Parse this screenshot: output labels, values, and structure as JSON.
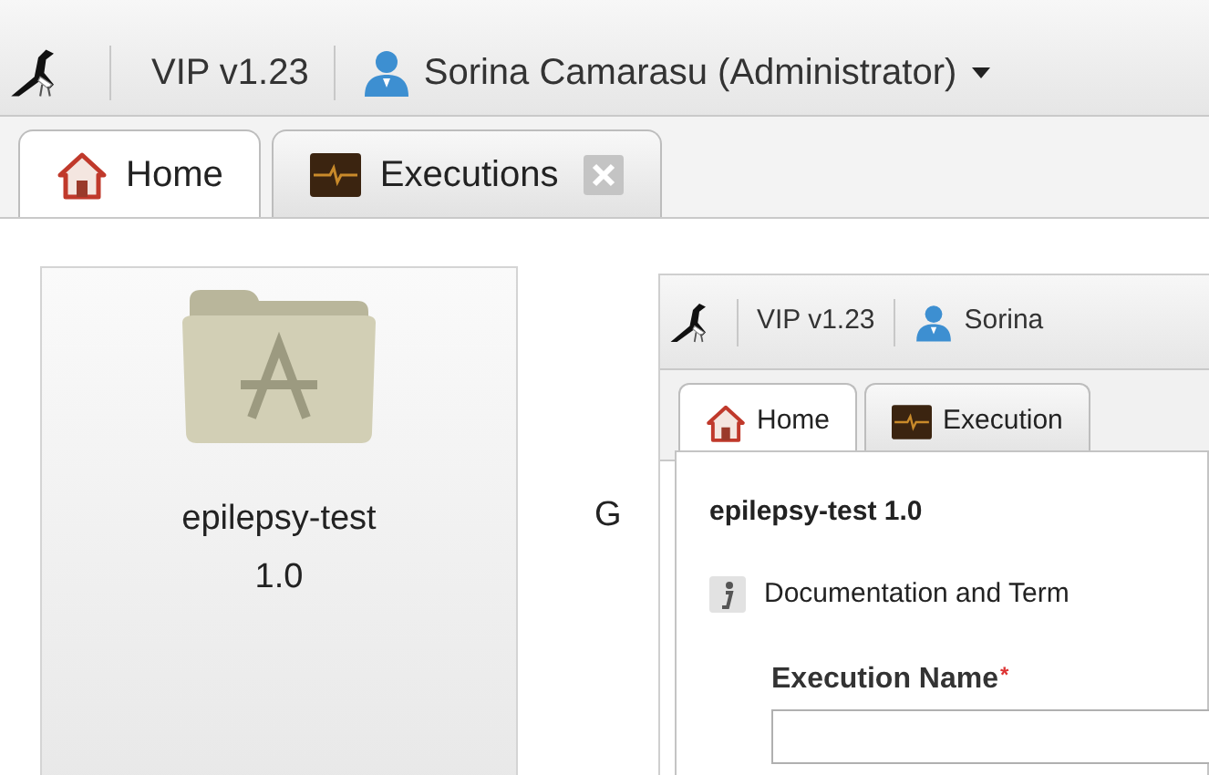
{
  "header": {
    "version": "VIP v1.23",
    "user": "Sorina Camarasu (Administrator)"
  },
  "tabs": [
    {
      "label": "Home",
      "kind": "home",
      "selected": true,
      "closable": false
    },
    {
      "label": "Executions",
      "kind": "executions",
      "selected": false,
      "closable": true
    }
  ],
  "apps": [
    {
      "name": "epilepsy-test",
      "version": "1.0"
    }
  ],
  "side_text": "G",
  "inset": {
    "header": {
      "version": "VIP v1.23",
      "user": "Sorina"
    },
    "tabs": [
      {
        "label": "Home",
        "kind": "home",
        "selected": true
      },
      {
        "label": "Execution",
        "kind": "executions",
        "selected": false
      }
    ],
    "dialog": {
      "title": "epilepsy-test 1.0",
      "doc_link": "Documentation and Term",
      "field_label": "Execution Name",
      "required_mark": "*"
    }
  }
}
